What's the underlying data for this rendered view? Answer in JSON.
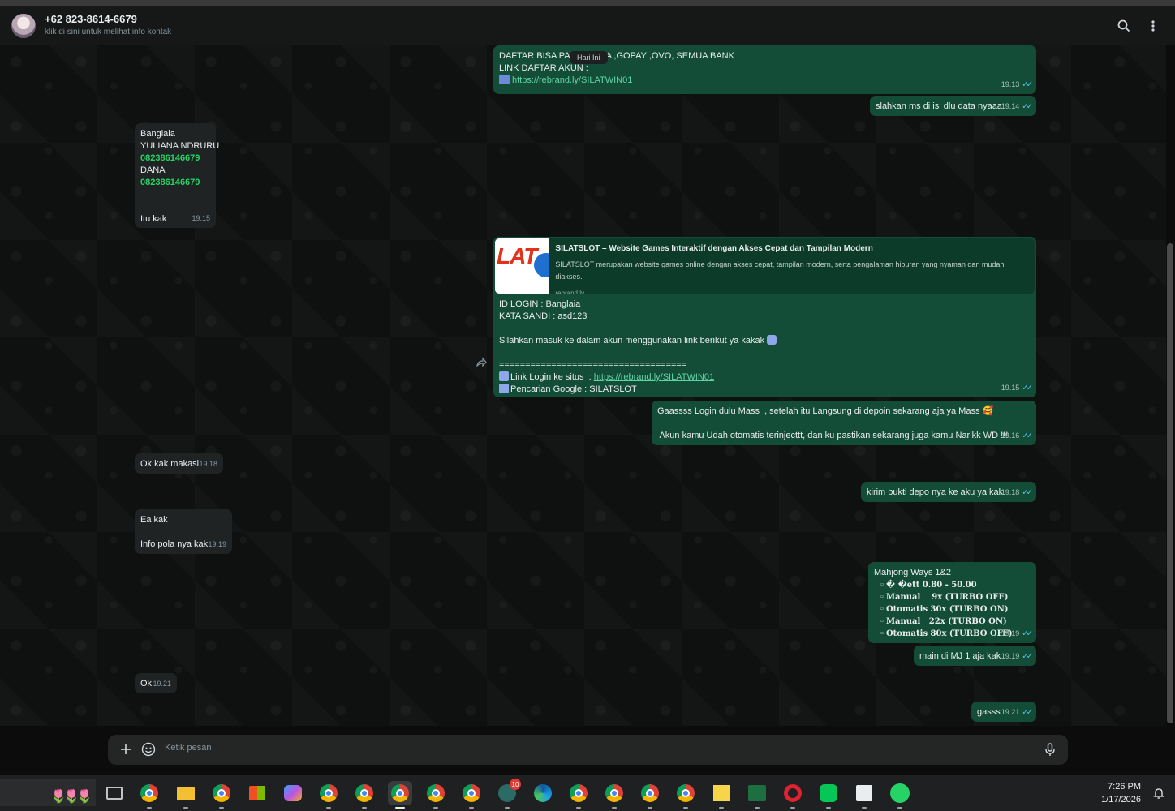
{
  "header": {
    "contact_name": "+62 823-8614-6679",
    "contact_sub": "klik di sini untuk melihat info kontak"
  },
  "date_chip": "Hari Ini",
  "messages": {
    "m1": {
      "lines": [
        "DAFTAR BISA PAKAI DANA ,GOPAY ,OVO, SEMUA BANK",
        "LINK DAFTAR AKUN :"
      ],
      "link": "https://rebrand.ly/SILATWIN01",
      "time": "19.13"
    },
    "m2": {
      "text": "slahkan ms di isi dlu data nyaaa",
      "time": "19.14"
    },
    "m3": {
      "l1": "Banglaia",
      "l2": "YULIANA NDRURU",
      "l3": "082386146679",
      "l4": "DANA",
      "l5": "082386146679",
      "l6": "Itu kak",
      "time": "19.15"
    },
    "m4": {
      "preview_title": "SILATSLOT – Website Games Interaktif dengan Akses Cepat dan Tampilan Modern",
      "preview_desc": "SILATSLOT merupakan website games online dengan akses cepat, tampilan modern, serta pengalaman hiburan yang nyaman dan mudah diakses.",
      "preview_host": "rebrand.ly",
      "l1": "ID LOGIN : Banglaia",
      "l2": "KATA SANDI : asd123",
      "l3": "Silahkan masuk ke dalam akun menggunakan link berikut ya kakak",
      "l4": "====================================",
      "l5_prefix": "Link Login ke situs  : ",
      "l5_link": "https://rebrand.ly/SILATWIN01",
      "l6": "Pencarian Google : SILATSLOT",
      "time": "19.15"
    },
    "m5": {
      "l1": "Gaassss Login dulu Mass  , setelah itu Langsung di depoin sekarang aja ya Mass 🥰",
      "l2": " Akun kamu Udah otomatis terinjecttt, dan ku pastikan sekarang juga kamu Narikk WD !!!",
      "time": "19.16"
    },
    "m6": {
      "text": "Ok kak makasi",
      "time": "19.18"
    },
    "m7": {
      "text": "kirim bukti depo nya ke aku ya kak",
      "time": "19.18"
    },
    "m8": {
      "l1": "Ea kak",
      "l2": "Info pola nya kak",
      "time": "19.19"
    },
    "m9": {
      "l1": "Mahjong Ways 1&2",
      "l2": "� �ett 0.80 - 50.00",
      "l3": "Manual    9x (TURBO OFF)",
      "l4": "Otomatis 30x (TURBO ON)",
      "l5": "Manual   22x (TURBO ON)",
      "l6": "Otomatis 80x (TURBO OFF)",
      "time": "19.19"
    },
    "m10": {
      "text": "main di MJ 1 aja kak",
      "time": "19.19"
    },
    "m11": {
      "text": "Ok",
      "time": "19.21"
    },
    "m12": {
      "text": "gasss",
      "time": "19.21"
    }
  },
  "composer": {
    "placeholder": "Ketik pesan"
  },
  "taskbar": {
    "time": "7:26 PM",
    "date": "1/17/2026",
    "badge": "10"
  },
  "icons": {
    "search": "search-icon",
    "menu": "more-vert-icon",
    "plus": "plus-icon",
    "sticker": "sticker-icon",
    "mic": "mic-icon",
    "forward": "forward-icon"
  },
  "colors": {
    "outgoing": "#144d37",
    "incoming": "#1f2324",
    "accent": "#25d366",
    "link": "#53bdeb"
  }
}
